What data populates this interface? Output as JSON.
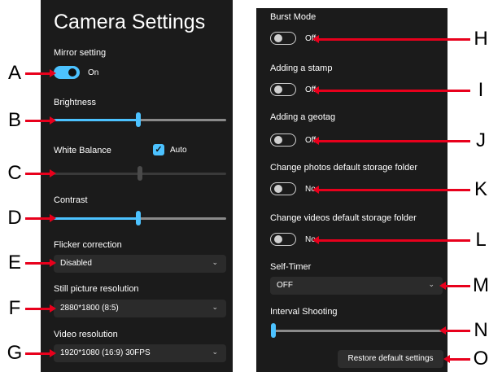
{
  "left_panel": {
    "title": "Camera Settings",
    "mirror": {
      "label": "Mirror setting",
      "state": "On",
      "on": true
    },
    "brightness": {
      "label": "Brightness",
      "value_fraction": 0.49
    },
    "white_balance": {
      "label": "White Balance",
      "auto_label": "Auto",
      "auto_checked": true,
      "value_fraction": 0.5
    },
    "contrast": {
      "label": "Contrast",
      "value_fraction": 0.49
    },
    "flicker": {
      "label": "Flicker correction",
      "value": "Disabled"
    },
    "still_resolution": {
      "label": "Still picture resolution",
      "value": "2880*1800 (8:5)"
    },
    "video_resolution": {
      "label": "Video resolution",
      "value": "1920*1080 (16:9) 30FPS"
    }
  },
  "right_panel": {
    "burst": {
      "label": "Burst Mode",
      "state": "Off",
      "on": false
    },
    "stamp": {
      "label": "Adding a stamp",
      "state": "Off",
      "on": false
    },
    "geotag": {
      "label": "Adding a geotag",
      "state": "Off",
      "on": false
    },
    "photos_folder": {
      "label": "Change photos default storage folder",
      "state": "No",
      "on": false
    },
    "videos_folder": {
      "label": "Change videos default storage folder",
      "state": "No",
      "on": false
    },
    "self_timer": {
      "label": "Self-Timer",
      "value": "OFF"
    },
    "interval": {
      "label": "Interval Shooting",
      "value_fraction": 0.0
    },
    "restore_button": "Restore default settings"
  },
  "callouts": {
    "A": "A",
    "B": "B",
    "C": "C",
    "D": "D",
    "E": "E",
    "F": "F",
    "G": "G",
    "H": "H",
    "I": "I",
    "J": "J",
    "K": "K",
    "L": "L",
    "M": "M",
    "N": "N",
    "O": "O"
  },
  "icons": {
    "chevron": "chevron-down-icon",
    "check": "checkmark-icon"
  },
  "colors": {
    "accent": "#4cc2ff",
    "panel_bg": "#1b1b1b",
    "callout_line": "#e8001c"
  }
}
